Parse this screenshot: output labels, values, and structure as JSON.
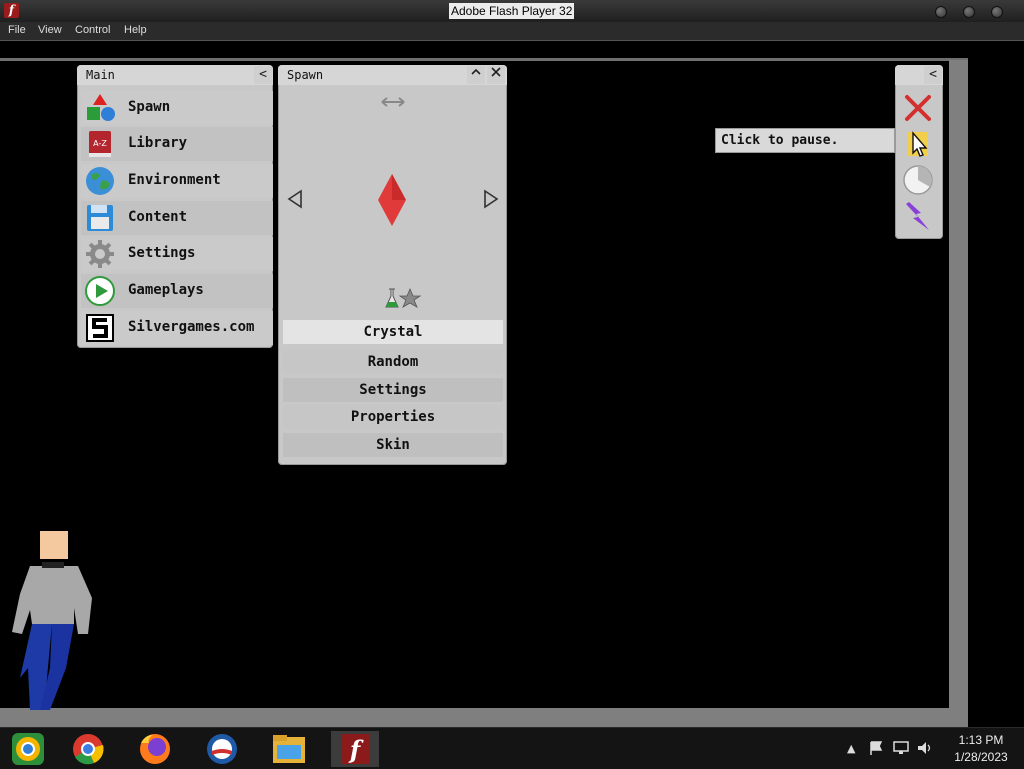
{
  "window": {
    "title": "Adobe Flash Player 32"
  },
  "menubar": {
    "items": [
      "File",
      "View",
      "Control",
      "Help"
    ]
  },
  "main_panel": {
    "title": "Main",
    "collapse_glyph": "<",
    "items": [
      {
        "label": "Spawn",
        "icon": "spawn-shapes-icon"
      },
      {
        "label": "Library",
        "icon": "library-book-icon"
      },
      {
        "label": "Environment",
        "icon": "globe-icon"
      },
      {
        "label": "Content",
        "icon": "floppy-disk-icon"
      },
      {
        "label": "Settings",
        "icon": "gear-icon"
      },
      {
        "label": "Gameplays",
        "icon": "play-icon"
      },
      {
        "label": "Silvergames.com",
        "icon": "silvergames-logo-icon"
      }
    ],
    "library_icon_text": "A-Z"
  },
  "spawn_panel": {
    "title": "Spawn",
    "selected_item": "Crystal",
    "options": [
      "Random",
      "Settings",
      "Properties",
      "Skin"
    ],
    "crystal_color": "#e03a3a"
  },
  "toolbar": {
    "collapse_glyph": "<",
    "tooltip": "Click to pause.",
    "tools": [
      "delete-x-icon",
      "cursor-pause-icon",
      "clock-icon",
      "lightning-icon"
    ]
  },
  "taskbar": {
    "apps": [
      "chrome-canary-icon",
      "chrome-icon",
      "firefox-icon",
      "obama-logo-icon",
      "file-explorer-icon",
      "flash-player-icon"
    ],
    "time": "1:13 PM",
    "date": "1/28/2023"
  },
  "colors": {
    "panel_bg": "#c8c8c8",
    "stage_bg": "#000000",
    "frame": "#7f7f7f",
    "character_shirt": "#a8a8a8",
    "character_pants": "#1d3aa6",
    "character_skin": "#f5c9a0"
  }
}
